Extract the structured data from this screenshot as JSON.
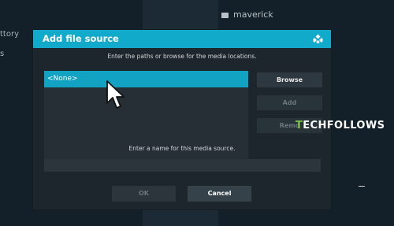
{
  "background": {
    "folder_label": "maverick",
    "left_text": "ttory",
    "left_text_2": "s"
  },
  "dialog": {
    "title": "Add file source",
    "instruction": "Enter the paths or browse for the media locations.",
    "path_items": [
      "<None>"
    ],
    "buttons": {
      "browse": "Browse",
      "add": "Add",
      "remove": "Remo"
    },
    "name_instruction": "Enter a name for this media source.",
    "name_value": "",
    "ok_label": "OK",
    "cancel_label": "Cancel"
  },
  "watermark": {
    "first_letter": "T",
    "rest": "ECHFOLLOWS"
  },
  "colors": {
    "accent": "#12aaca",
    "selected_item": "#12a2c2",
    "dialog_bg": "#1d262c",
    "watermark_green": "#7cc244"
  }
}
